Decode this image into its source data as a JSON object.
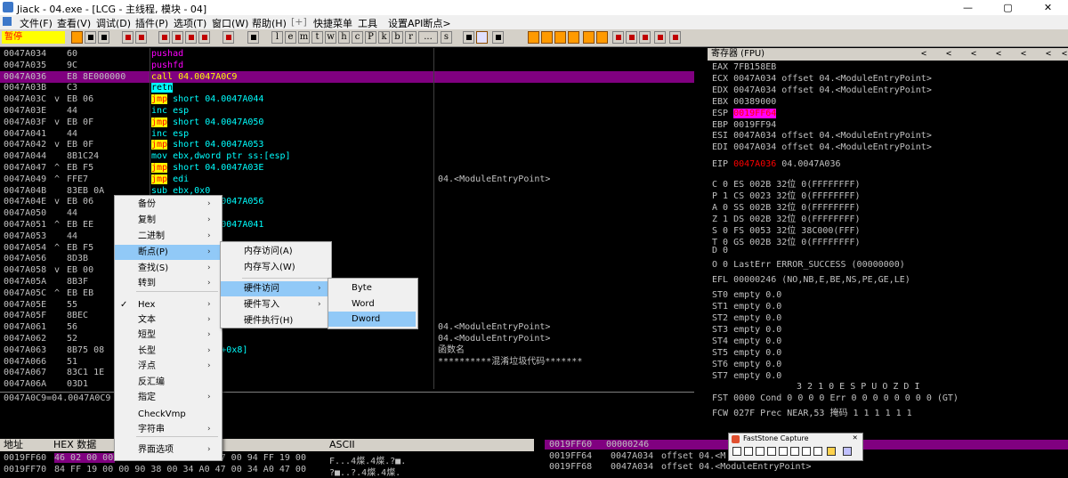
{
  "window": {
    "title": "Jiack - 04.exe - [LCG - 主线程, 模块 - 04]",
    "minimize": "—",
    "maximize": "▢",
    "close": "✕"
  },
  "menu": [
    "文件(F)",
    "查看(V)",
    "调试(D)",
    "插件(P)",
    "选项(T)",
    "窗口(W)",
    "帮助(H)",
    "[+]",
    "快捷菜单",
    "工具",
    "设置API断点>"
  ],
  "toolbar": {
    "status": "暂停",
    "letters": [
      "l",
      "e",
      "m",
      "t",
      "w",
      "h",
      "c",
      "P",
      "k",
      "b",
      "r",
      "...",
      "s"
    ]
  },
  "disasm": [
    {
      "addr": "0047A034",
      "mk": "",
      "hex": "60",
      "asm": "pushad",
      "kind": "push",
      "cmt": ""
    },
    {
      "addr": "0047A035",
      "mk": "",
      "hex": "9C",
      "asm": "pushfd",
      "kind": "push",
      "cmt": ""
    },
    {
      "addr": "0047A036",
      "mk": "",
      "hex": "E8 8E000000",
      "asm": "call 04.0047A0C9",
      "kind": "call",
      "cmt": "",
      "sel": true
    },
    {
      "addr": "0047A03B",
      "mk": "",
      "hex": "C3",
      "asm": "retn",
      "kind": "retn",
      "cmt": ""
    },
    {
      "addr": "0047A03C",
      "mk": "v",
      "hex": "EB 06",
      "asm": "jmp short 04.0047A044",
      "kind": "jmp",
      "cmt": ""
    },
    {
      "addr": "0047A03E",
      "mk": "",
      "hex": "44",
      "asm": "inc esp",
      "kind": "plain",
      "cmt": ""
    },
    {
      "addr": "0047A03F",
      "mk": "v",
      "hex": "EB 0F",
      "asm": "jmp short 04.0047A050",
      "kind": "jmp",
      "cmt": ""
    },
    {
      "addr": "0047A041",
      "mk": "",
      "hex": "44",
      "asm": "inc esp",
      "kind": "plain",
      "cmt": ""
    },
    {
      "addr": "0047A042",
      "mk": "v",
      "hex": "EB 0F",
      "asm": "jmp short 04.0047A053",
      "kind": "jmp",
      "cmt": ""
    },
    {
      "addr": "0047A044",
      "mk": "",
      "hex": "8B1C24",
      "asm": "mov ebx,dword ptr ss:[esp]",
      "kind": "plain",
      "cmt": ""
    },
    {
      "addr": "0047A047",
      "mk": "^",
      "hex": "EB F5",
      "asm": "jmp short 04.0047A03E",
      "kind": "jmp",
      "cmt": ""
    },
    {
      "addr": "0047A049",
      "mk": "^",
      "hex": "FFE7",
      "asm": "jmp edi",
      "kind": "jmp",
      "cmt": "04.<ModuleEntryPoint>"
    },
    {
      "addr": "0047A04B",
      "mk": "",
      "hex": "83EB 0A",
      "asm": "sub ebx,0x0",
      "kind": "plain",
      "cmt": ""
    },
    {
      "addr": "0047A04E",
      "mk": "v",
      "hex": "EB 06",
      "asm": "jmp short 04.0047A056",
      "kind": "jmp",
      "cmt": ""
    },
    {
      "addr": "0047A050",
      "mk": "",
      "hex": "44",
      "asm": "",
      "kind": "plain",
      "cmt": ""
    },
    {
      "addr": "0047A051",
      "mk": "^",
      "hex": "EB EE",
      "asm": "jmp short 04.0047A041",
      "kind": "jmp",
      "cmt": ""
    },
    {
      "addr": "0047A053",
      "mk": "",
      "hex": "44",
      "asm": "",
      "kind": "plain",
      "cmt": ""
    },
    {
      "addr": "0047A054",
      "mk": "^",
      "hex": "EB F5",
      "asm": "",
      "kind": "plain",
      "cmt": ""
    },
    {
      "addr": "0047A056",
      "mk": "",
      "hex": "8D3B",
      "asm": "",
      "kind": "plain",
      "cmt": ""
    },
    {
      "addr": "0047A058",
      "mk": "v",
      "hex": "EB 00",
      "asm": "",
      "kind": "plain",
      "cmt": ""
    },
    {
      "addr": "0047A05A",
      "mk": "",
      "hex": "8B3F",
      "asm": "",
      "kind": "plain",
      "cmt": ""
    },
    {
      "addr": "0047A05C",
      "mk": "^",
      "hex": "EB EB",
      "asm": "",
      "kind": "plain",
      "cmt": ""
    },
    {
      "addr": "0047A05E",
      "mk": "",
      "hex": "55",
      "asm": "",
      "kind": "plain",
      "cmt": ""
    },
    {
      "addr": "0047A05F",
      "mk": "",
      "hex": "8BEC",
      "asm": "",
      "kind": "plain",
      "cmt": ""
    },
    {
      "addr": "0047A061",
      "mk": "",
      "hex": "56",
      "asm": "",
      "kind": "plain",
      "cmt": "04.<ModuleEntryPoint>"
    },
    {
      "addr": "0047A062",
      "mk": "",
      "hex": "52",
      "asm": "",
      "kind": "plain",
      "cmt": "04.<ModuleEntryPoint>"
    },
    {
      "addr": "0047A063",
      "mk": "",
      "hex": "8B75 08",
      "asm": "d ptr ss:[ebp+0x8]",
      "kind": "plain",
      "cmt": "函数名"
    },
    {
      "addr": "0047A066",
      "mk": "",
      "hex": "51",
      "asm": "",
      "kind": "plain",
      "cmt": "**********混淆垃圾代码*******"
    },
    {
      "addr": "0047A067",
      "mk": "",
      "hex": "83C1 1E",
      "asm": "",
      "kind": "plain",
      "cmt": ""
    },
    {
      "addr": "0047A06A",
      "mk": "",
      "hex": "03D1",
      "asm": "",
      "kind": "plain",
      "cmt": ""
    }
  ],
  "info": {
    "line": "0047A0C9=04.0047A0C9"
  },
  "registers": {
    "header": "寄存器 (FPU)",
    "nav": [
      "<",
      "<",
      "<",
      "<",
      "<",
      "<",
      "<"
    ],
    "gp": [
      {
        "name": "EAX",
        "val": "7FB158EB",
        "note": ""
      },
      {
        "name": "ECX",
        "val": "0047A034",
        "note": "offset 04.<ModuleEntryPoint>"
      },
      {
        "name": "EDX",
        "val": "0047A034",
        "note": "offset 04.<ModuleEntryPoint>"
      },
      {
        "name": "EBX",
        "val": "00389000",
        "note": ""
      },
      {
        "name": "ESP",
        "val": "0019FF64",
        "note": "",
        "hl": true
      },
      {
        "name": "EBP",
        "val": "0019FF94",
        "note": ""
      },
      {
        "name": "ESI",
        "val": "0047A034",
        "note": "offset 04.<ModuleEntryPoint>"
      },
      {
        "name": "EDI",
        "val": "0047A034",
        "note": "offset 04.<ModuleEntryPoint>"
      }
    ],
    "eip": {
      "name": "EIP",
      "val": "0047A036",
      "note": "04.0047A036"
    },
    "seg": [
      "C 0  ES 002B 32位 0(FFFFFFFF)",
      "P 1  CS 0023 32位 0(FFFFFFFF)",
      "A 0  SS 002B 32位 0(FFFFFFFF)",
      "Z 1  DS 002B 32位 0(FFFFFFFF)",
      "S 0  FS 0053 32位 38C000(FFF)",
      "T 0  GS 002B 32位 0(FFFFFFFF)",
      "D 0"
    ],
    "lasterr": "O 0  LastErr ERROR_SUCCESS (00000000)",
    "efl": "EFL 00000246 (NO,NB,E,BE,NS,PE,GE,LE)",
    "fpu": [
      "ST0 empty 0.0",
      "ST1 empty 0.0",
      "ST2 empty 0.0",
      "ST3 empty 0.0",
      "ST4 empty 0.0",
      "ST5 empty 0.0",
      "ST6 empty 0.0",
      "ST7 empty 0.0"
    ],
    "bits": "3 2 1 0      E S P U O Z D I",
    "fst": "FST 0000  Cond 0 0 0 0  Err 0 0 0 0 0 0 0 0  (GT)",
    "fcw": "FCW 027F  Prec NEAR,53  掩码    1 1 1 1 1 1"
  },
  "dump": {
    "col_addr": "地址",
    "col_hex": "HEX 数据",
    "col_ascii": "ASCII",
    "rows": [
      {
        "addr": "0019FF60",
        "hex": "46 02 00 00 34 A0 47 00 34 A0 47 00 94 FF 19 00",
        "ascii": "F...4燦.4燦.?■."
      },
      {
        "addr": "0019FF70",
        "hex": "84 FF 19 00 00 90 38 00 34 A0 47 00 34 A0 47 00",
        "ascii": "?■..?.4燦.4燦."
      }
    ]
  },
  "stack": [
    {
      "addr": "0019FF60",
      "val": "00000246",
      "note": "",
      "sel": true
    },
    {
      "addr": "0019FF64",
      "val": "0047A034",
      "note": "offset 04.<M"
    },
    {
      "addr": "0019FF68",
      "val": "0047A034",
      "note": "offset 04.<ModuleEntryPoint>"
    }
  ],
  "context_menu": {
    "items": [
      {
        "label": "备份",
        "sub": true
      },
      {
        "label": "复制",
        "sub": true
      },
      {
        "label": "二进制",
        "sub": true
      },
      {
        "label": "断点(P)",
        "sub": true,
        "hover": true
      },
      {
        "label": "查找(S)",
        "sub": true
      },
      {
        "label": "转到",
        "sub": true
      },
      {
        "label": "Hex",
        "sub": true,
        "checked": true
      },
      {
        "label": "文本",
        "sub": true
      },
      {
        "label": "短型",
        "sub": true
      },
      {
        "label": "长型",
        "sub": true
      },
      {
        "label": "浮点",
        "sub": true
      },
      {
        "label": "反汇编",
        "sub": false
      },
      {
        "label": "指定",
        "sub": true
      },
      {
        "label": "CheckVmp",
        "sub": false
      },
      {
        "label": "字符串",
        "sub": true
      },
      {
        "label": "界面选项",
        "sub": true
      }
    ],
    "check_mark": "✓",
    "arrow": "›"
  },
  "submenu_breakpoint": [
    {
      "label": "内存访问(A)",
      "sub": false
    },
    {
      "label": "内存写入(W)",
      "sub": false
    },
    {
      "label": "硬件访问",
      "sub": true,
      "hover": true
    },
    {
      "label": "硬件写入",
      "sub": true
    },
    {
      "label": "硬件执行(H)",
      "sub": false
    }
  ],
  "submenu_hw": [
    {
      "label": "Byte",
      "hover": false
    },
    {
      "label": "Word",
      "hover": false
    },
    {
      "label": "Dword",
      "hover": true
    }
  ],
  "faststone": {
    "title": "FastStone Capture",
    "close": "✕"
  }
}
